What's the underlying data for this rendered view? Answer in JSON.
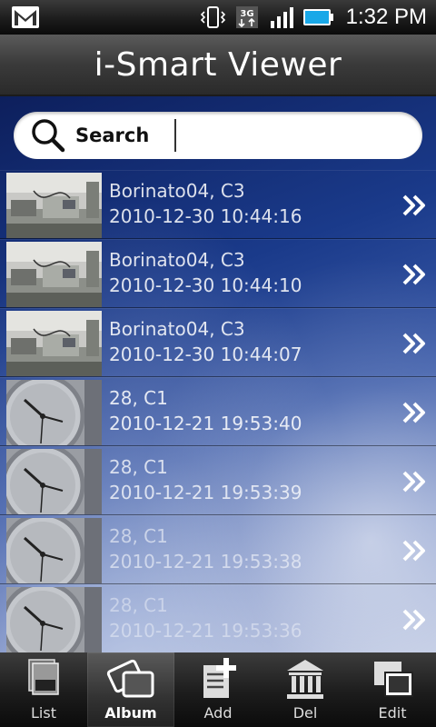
{
  "statusbar": {
    "time": "1:32 PM",
    "icons": [
      "gmail-icon",
      "vibrate-icon",
      "3g-icon",
      "signal-icon",
      "battery-icon"
    ]
  },
  "header": {
    "title": "i-Smart Viewer"
  },
  "search": {
    "label": "Search",
    "value": ""
  },
  "list": {
    "items": [
      {
        "name": "Borinato04, C3",
        "time": "2010-12-30 10:44:16",
        "thumb": "lab"
      },
      {
        "name": "Borinato04, C3",
        "time": "2010-12-30 10:44:10",
        "thumb": "lab"
      },
      {
        "name": "Borinato04, C3",
        "time": "2010-12-30 10:44:07",
        "thumb": "lab"
      },
      {
        "name": "28, C1",
        "time": "2010-12-21 19:53:40",
        "thumb": "clock"
      },
      {
        "name": "28, C1",
        "time": "2010-12-21 19:53:39",
        "thumb": "clock"
      },
      {
        "name": "28, C1",
        "time": "2010-12-21 19:53:38",
        "thumb": "clock"
      },
      {
        "name": "28, C1",
        "time": "2010-12-21 19:53:36",
        "thumb": "clock"
      }
    ]
  },
  "tabbar": {
    "tabs": [
      {
        "label": "List",
        "icon": "list-icon",
        "active": false
      },
      {
        "label": "Album",
        "icon": "album-icon",
        "active": true
      },
      {
        "label": "Add",
        "icon": "add-icon",
        "active": false
      },
      {
        "label": "Del",
        "icon": "delete-icon",
        "active": false
      },
      {
        "label": "Edit",
        "icon": "edit-icon",
        "active": false
      }
    ]
  },
  "colors": {
    "background_top": "#0d1f5c",
    "background_bottom": "#b9c4e0",
    "bar": "#2a2a2a"
  }
}
